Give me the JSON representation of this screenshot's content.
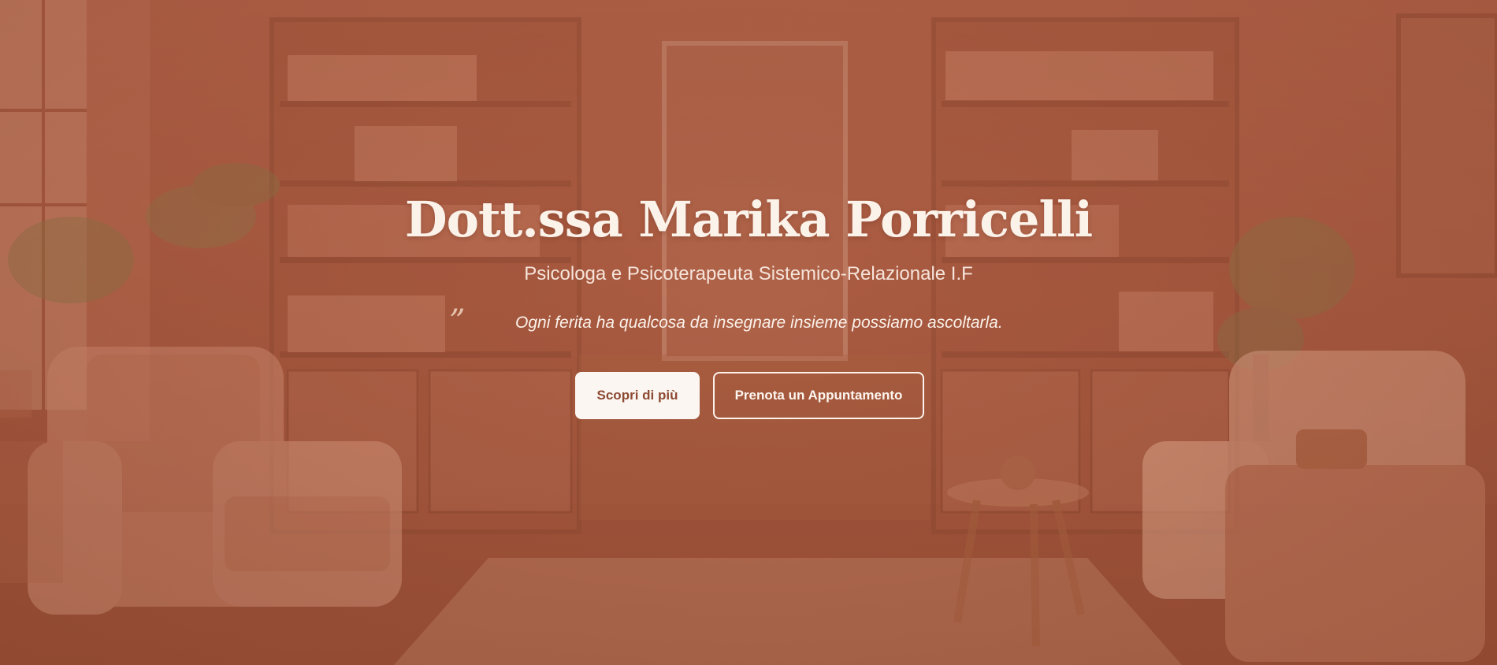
{
  "hero": {
    "title": "Dott.ssa Marika Porricelli",
    "subtitle": "Psicologa e Psicoterapeuta Sistemico-Relazionale I.F",
    "quote_mark": "”",
    "quote": "Ogni ferita ha qualcosa da insegnare insieme possiamo ascoltarla.",
    "buttons": {
      "primary_label": "Scopri di più",
      "secondary_label": "Prenota un Appuntamento"
    }
  },
  "colors": {
    "overlay_tint": "#a95b41",
    "title_text": "#fbf2ea",
    "primary_button_bg": "#fbf6f1",
    "primary_button_text": "#8d4a33",
    "outline_button_border": "#fdf3ec"
  },
  "background": {
    "scene": "therapy-room-photo",
    "elements": [
      "window",
      "bookshelf-left",
      "bookshelf-right",
      "framed-picture",
      "armchair-left",
      "armchair-right",
      "side-table",
      "plant-left",
      "plant-right",
      "rug"
    ]
  }
}
